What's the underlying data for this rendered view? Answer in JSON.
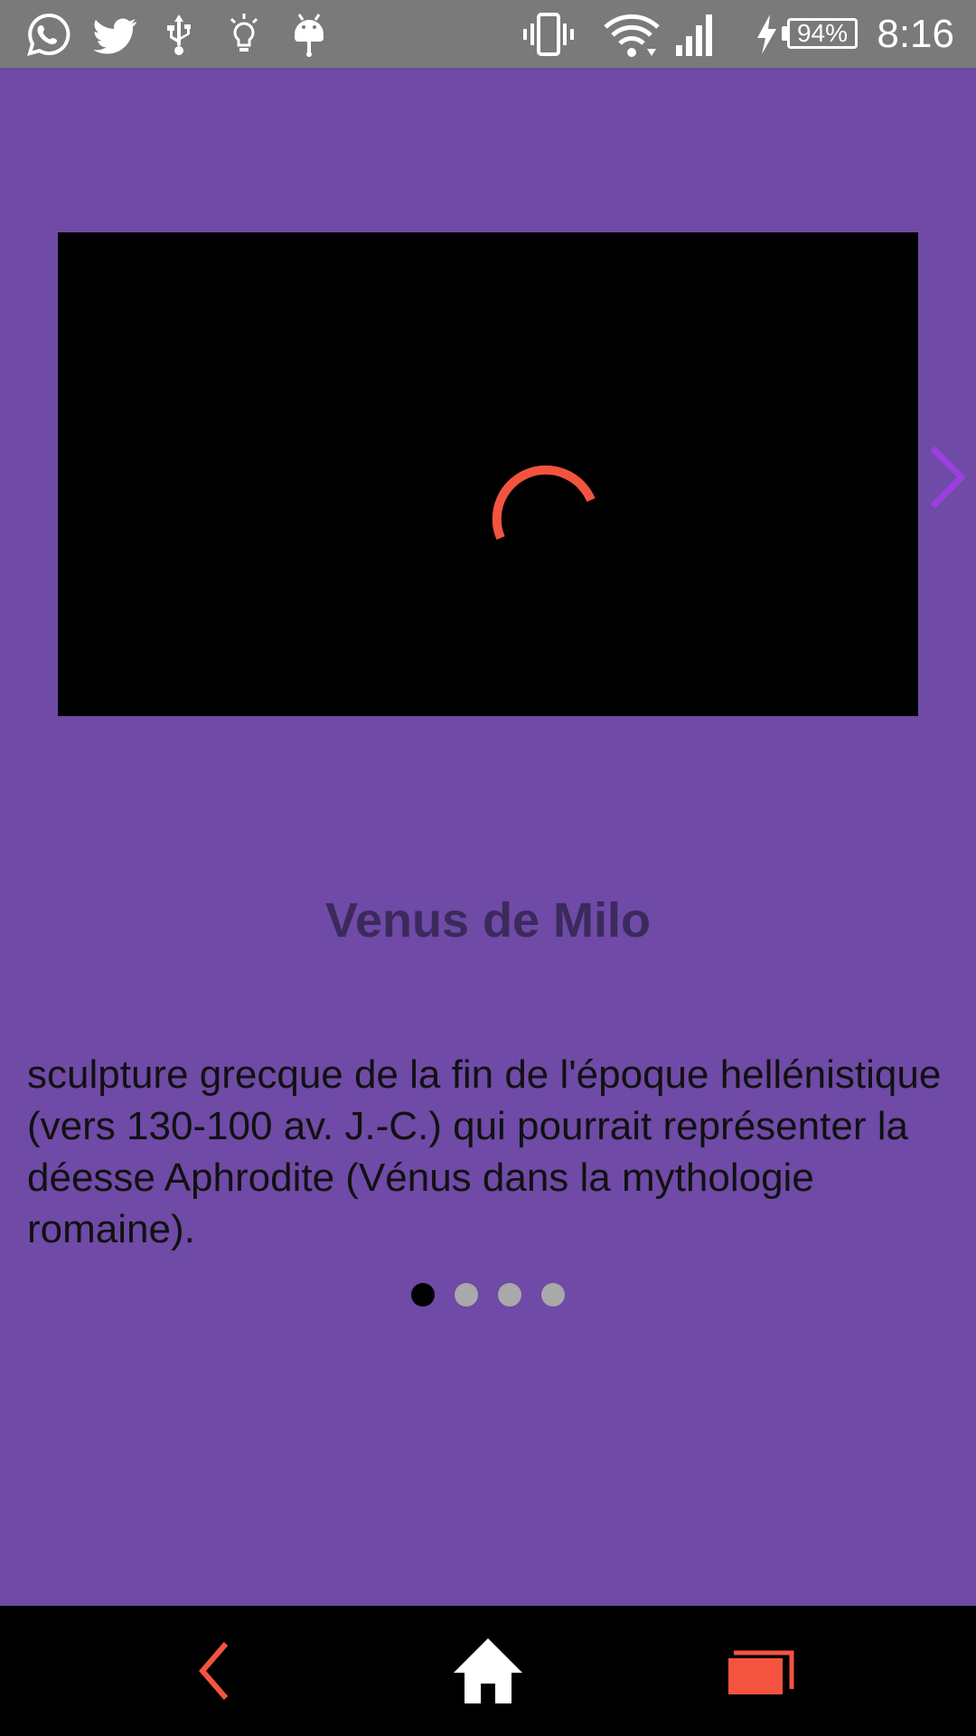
{
  "status_bar": {
    "time": "8:16",
    "battery_level": "94%",
    "icons": [
      "whatsapp-icon",
      "twitter-icon",
      "usb-icon",
      "lightbulb-icon",
      "android-icon",
      "vibrate-icon",
      "wifi-icon",
      "signal-icon",
      "charging-icon",
      "battery-icon"
    ]
  },
  "media": {
    "state": "loading",
    "spinner_color": "#f4543f"
  },
  "carousel": {
    "title": "Venus de Milo",
    "description": "sculpture grecque de la fin de l'époque hellénistique (vers 130-100 av. J.-C.) qui pourrait représenter la déesse Aphrodite (Vénus dans la mythologie romaine).",
    "page_count": 4,
    "active_page": 1,
    "next_icon": "chevron-right-icon"
  },
  "nav_bar": {
    "buttons": [
      "back-icon",
      "home-icon",
      "recent-apps-icon"
    ]
  },
  "colors": {
    "background": "#6f4aa6",
    "status_bar": "#7a7a7a",
    "title": "#3b2a5c",
    "accent": "#f4543f",
    "next_arrow": "#9b3fe0"
  }
}
